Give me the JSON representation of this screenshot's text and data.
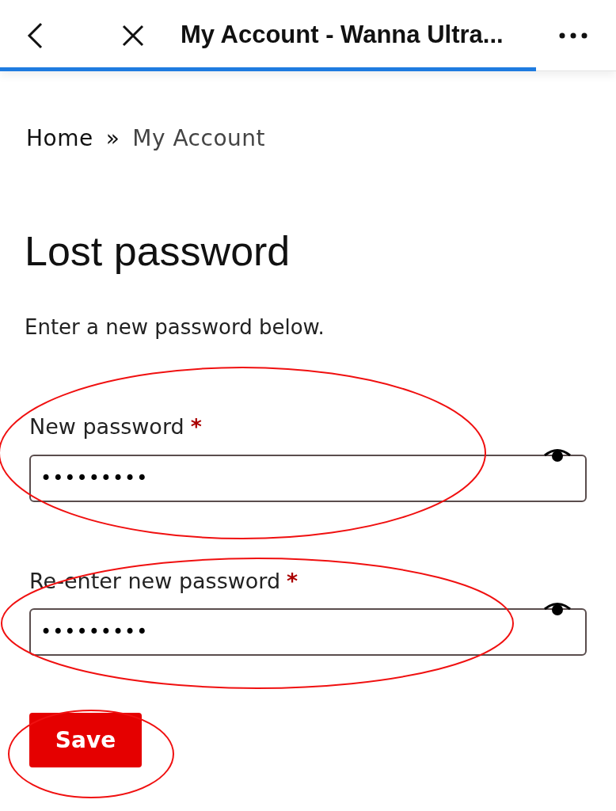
{
  "browser_bar": {
    "title": "My Account - Wanna Ultra...",
    "progress": {
      "level": 0.87
    }
  },
  "breadcrumb": [
    {
      "label": "Home",
      "kind": "link"
    },
    {
      "label": "»",
      "kind": "separator"
    },
    {
      "label": "My Account",
      "kind": "current"
    }
  ],
  "heading": "Lost password",
  "intro": "Enter a new password below.",
  "fields": [
    {
      "label": "New password",
      "required_mark": "*",
      "value": "•••••••••",
      "circled": true
    },
    {
      "label": "Re-enter new password",
      "required_mark": "*",
      "value": "•••••••••",
      "circled": true
    }
  ],
  "save_button": {
    "label": "Save",
    "circled": true
  }
}
